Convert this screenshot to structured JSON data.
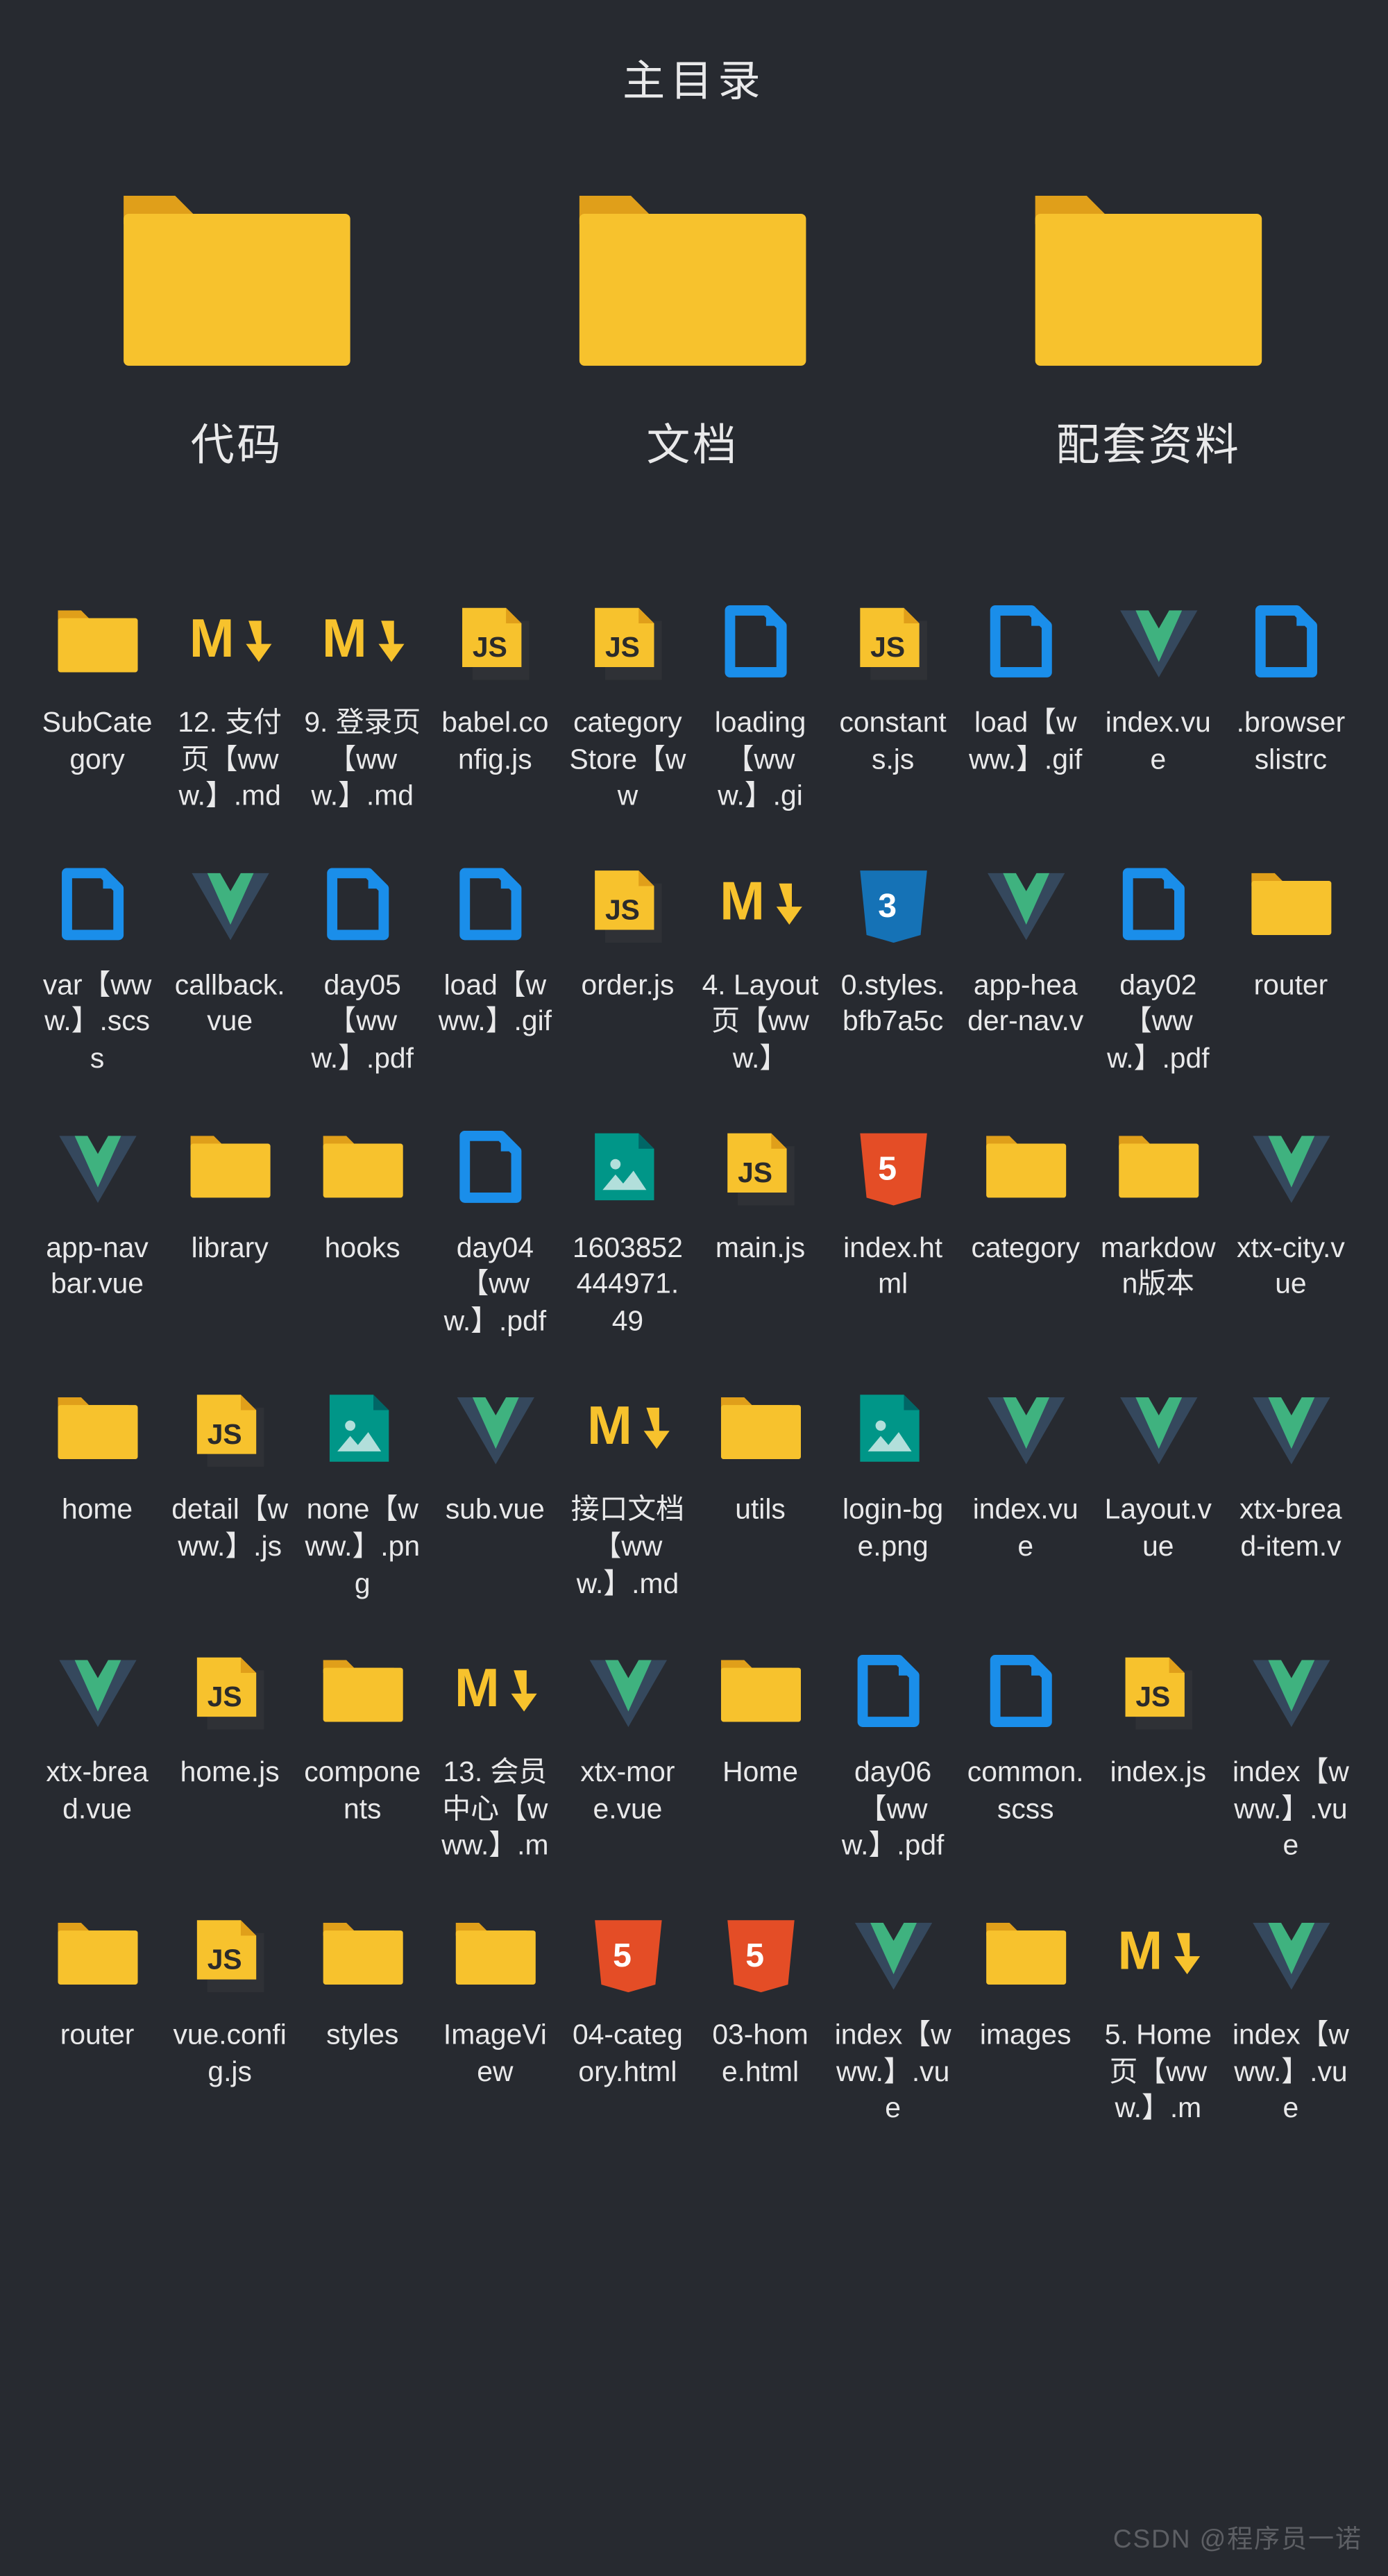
{
  "title": "主目录",
  "watermark": "CSDN @程序员一诺",
  "topFolders": [
    {
      "label": "代码",
      "icon": "folder"
    },
    {
      "label": "文档",
      "icon": "folder"
    },
    {
      "label": "配套资料",
      "icon": "folder"
    }
  ],
  "items": [
    {
      "label": "SubCategory",
      "icon": "folder"
    },
    {
      "label": "12. 支付页【www.】.md",
      "icon": "md"
    },
    {
      "label": "9. 登录页【www.】.md",
      "icon": "md"
    },
    {
      "label": "babel.config.js",
      "icon": "js"
    },
    {
      "label": "categoryStore【ww",
      "icon": "js"
    },
    {
      "label": "loading【www.】.gi",
      "icon": "file-blue"
    },
    {
      "label": "constants.js",
      "icon": "js"
    },
    {
      "label": "load【www.】.gif",
      "icon": "file-blue"
    },
    {
      "label": "index.vue",
      "icon": "vue"
    },
    {
      "label": ".browserslistrc",
      "icon": "file-blue"
    },
    {
      "label": "var【www.】.scss",
      "icon": "file-blue"
    },
    {
      "label": "callback.vue",
      "icon": "vue"
    },
    {
      "label": "day05【www.】.pdf",
      "icon": "file-blue"
    },
    {
      "label": "load【www.】.gif",
      "icon": "file-blue"
    },
    {
      "label": "order.js",
      "icon": "js"
    },
    {
      "label": "4. Layout页【www.】",
      "icon": "md"
    },
    {
      "label": "0.styles.bfb7a5c",
      "icon": "css3"
    },
    {
      "label": "app-header-nav.v",
      "icon": "vue"
    },
    {
      "label": "day02【www.】.pdf",
      "icon": "file-blue"
    },
    {
      "label": "router",
      "icon": "folder"
    },
    {
      "label": "app-navbar.vue",
      "icon": "vue"
    },
    {
      "label": "library",
      "icon": "folder"
    },
    {
      "label": "hooks",
      "icon": "folder"
    },
    {
      "label": "day04【www.】.pdf",
      "icon": "file-blue"
    },
    {
      "label": "1603852444971.49",
      "icon": "image-teal"
    },
    {
      "label": "main.js",
      "icon": "js"
    },
    {
      "label": "index.html",
      "icon": "html5"
    },
    {
      "label": "category",
      "icon": "folder"
    },
    {
      "label": "markdown版本",
      "icon": "folder"
    },
    {
      "label": "xtx-city.vue",
      "icon": "vue"
    },
    {
      "label": "home",
      "icon": "folder"
    },
    {
      "label": "detail【www.】.js",
      "icon": "js"
    },
    {
      "label": "none【www.】.png",
      "icon": "image-teal"
    },
    {
      "label": "sub.vue",
      "icon": "vue"
    },
    {
      "label": "接口文档【www.】.md",
      "icon": "md"
    },
    {
      "label": "utils",
      "icon": "folder"
    },
    {
      "label": "login-bge.png",
      "icon": "image-teal"
    },
    {
      "label": "index.vue",
      "icon": "vue"
    },
    {
      "label": "Layout.vue",
      "icon": "vue"
    },
    {
      "label": "xtx-bread-item.v",
      "icon": "vue"
    },
    {
      "label": "xtx-bread.vue",
      "icon": "vue"
    },
    {
      "label": "home.js",
      "icon": "js"
    },
    {
      "label": "components",
      "icon": "folder"
    },
    {
      "label": "13. 会员中心【www.】.m",
      "icon": "md"
    },
    {
      "label": "xtx-more.vue",
      "icon": "vue"
    },
    {
      "label": "Home",
      "icon": "folder"
    },
    {
      "label": "day06【www.】.pdf",
      "icon": "file-blue"
    },
    {
      "label": "common.scss",
      "icon": "file-blue"
    },
    {
      "label": "index.js",
      "icon": "js"
    },
    {
      "label": "index【www.】.vue",
      "icon": "vue"
    },
    {
      "label": "router",
      "icon": "folder"
    },
    {
      "label": "vue.config.js",
      "icon": "js"
    },
    {
      "label": "styles",
      "icon": "folder"
    },
    {
      "label": "ImageView",
      "icon": "folder"
    },
    {
      "label": "04-category.html",
      "icon": "html5"
    },
    {
      "label": "03-home.html",
      "icon": "html5"
    },
    {
      "label": "index【www.】.vue",
      "icon": "vue"
    },
    {
      "label": "images",
      "icon": "folder"
    },
    {
      "label": "5. Home页【www.】.m",
      "icon": "md"
    },
    {
      "label": "index【www.】.vue",
      "icon": "vue"
    }
  ],
  "iconNames": {
    "folder": "folder-icon",
    "md": "markdown-icon",
    "js": "javascript-file-icon",
    "file-blue": "generic-file-icon",
    "vue": "vue-file-icon",
    "css3": "css3-icon",
    "html5": "html5-icon",
    "image-teal": "image-file-icon"
  }
}
